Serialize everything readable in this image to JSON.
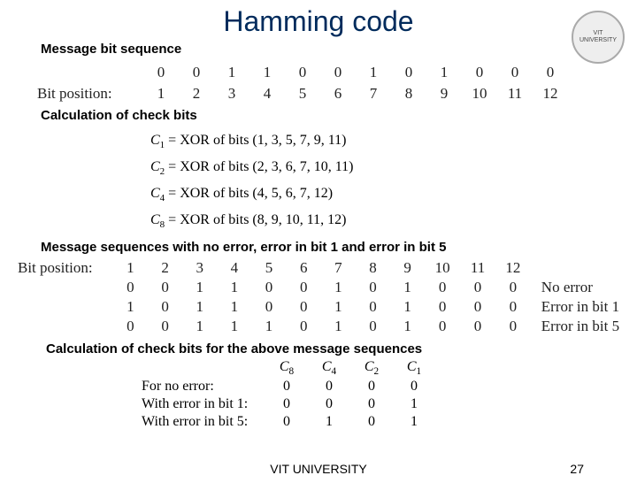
{
  "title": "Hamming code",
  "logo": {
    "line1": "VIT",
    "line2": "UNIVERSITY"
  },
  "labels": {
    "msg_bit_seq": "Message bit sequence",
    "calc_check_bits": "Calculation of check bits",
    "msg_seq_errors": "Message sequences with no error, error in bit 1 and error in bit 5",
    "calc_check_above": "Calculation of check bits for the above message sequences",
    "bit_position": "Bit position:"
  },
  "bit_seq": {
    "values": [
      "0",
      "0",
      "1",
      "1",
      "0",
      "0",
      "1",
      "0",
      "1",
      "0",
      "0",
      "0"
    ],
    "positions": [
      "1",
      "2",
      "3",
      "4",
      "5",
      "6",
      "7",
      "8",
      "9",
      "10",
      "11",
      "12"
    ]
  },
  "check_equations": [
    {
      "name": "C",
      "sub": "1",
      "rhs": "= XOR of bits (1, 3, 5, 7, 9, 11)"
    },
    {
      "name": "C",
      "sub": "2",
      "rhs": "= XOR of bits (2, 3, 6, 7, 10, 11)"
    },
    {
      "name": "C",
      "sub": "4",
      "rhs": "= XOR of bits (4, 5, 6, 7, 12)"
    },
    {
      "name": "C",
      "sub": "8",
      "rhs": "= XOR of bits (8, 9, 10, 11, 12)"
    }
  ],
  "error_table": {
    "head_positions": [
      "1",
      "2",
      "3",
      "4",
      "5",
      "6",
      "7",
      "8",
      "9",
      "10",
      "11",
      "12"
    ],
    "rows": [
      {
        "bits": [
          "0",
          "0",
          "1",
          "1",
          "0",
          "0",
          "1",
          "0",
          "1",
          "0",
          "0",
          "0"
        ],
        "label": "No error"
      },
      {
        "bits": [
          "1",
          "0",
          "1",
          "1",
          "0",
          "0",
          "1",
          "0",
          "1",
          "0",
          "0",
          "0"
        ],
        "label": "Error in bit 1"
      },
      {
        "bits": [
          "0",
          "0",
          "1",
          "1",
          "1",
          "0",
          "1",
          "0",
          "1",
          "0",
          "0",
          "0"
        ],
        "label": "Error in bit 5"
      }
    ]
  },
  "syndrome": {
    "headers": [
      "C",
      "C",
      "C",
      "C"
    ],
    "header_subs": [
      "8",
      "4",
      "2",
      "1"
    ],
    "rows": [
      {
        "label": "For no error:",
        "vals": [
          "0",
          "0",
          "0",
          "0"
        ]
      },
      {
        "label": "With error in bit 1:",
        "vals": [
          "0",
          "0",
          "0",
          "1"
        ]
      },
      {
        "label": "With error in bit 5:",
        "vals": [
          "0",
          "1",
          "0",
          "1"
        ]
      }
    ]
  },
  "footer": {
    "university": "VIT UNIVERSITY",
    "page": "27"
  }
}
